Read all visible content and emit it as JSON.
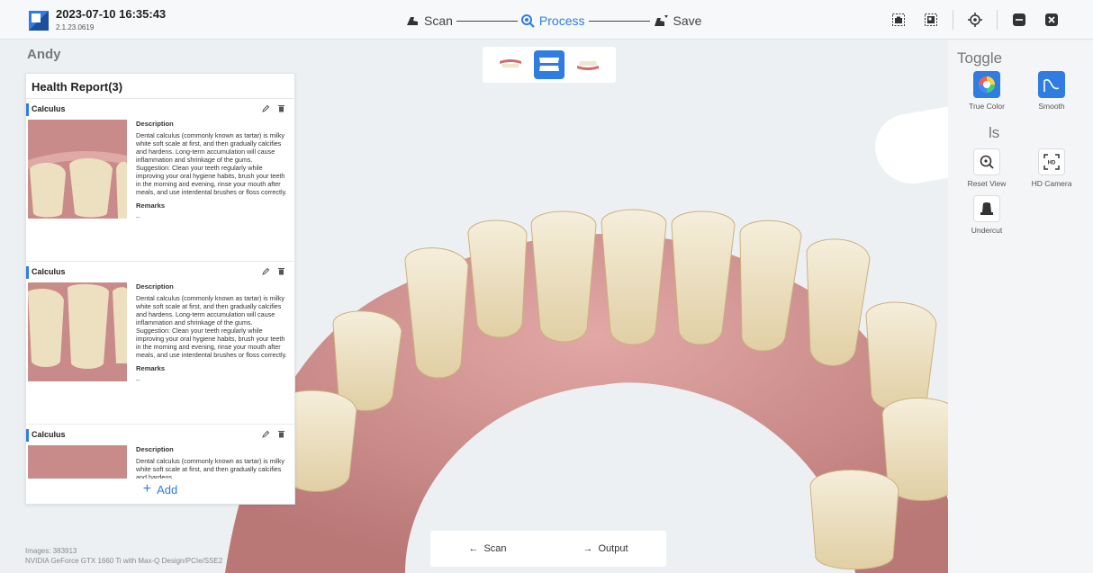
{
  "header": {
    "timestamp": "2023-07-10 16:35:43",
    "version": "2.1.23.0619",
    "steps": [
      {
        "label": "Scan",
        "icon": "scanner-icon",
        "active": false
      },
      {
        "label": "Process",
        "icon": "process-icon",
        "active": true
      },
      {
        "label": "Save",
        "icon": "save-icon",
        "active": false
      }
    ],
    "window_controls": [
      "screenshot-icon",
      "image-icon",
      "target-icon",
      "minimize-icon",
      "close-icon"
    ]
  },
  "patient": {
    "name": "Andy"
  },
  "health_report": {
    "title": "Health Report(3)",
    "desc_label": "Description",
    "remarks_label": "Remarks",
    "remarks_value": "--",
    "findings": [
      {
        "name": "Calculus",
        "description": "Dental calculus (commonly known as tartar) is milky white soft scale at first, and then gradually calcifies and hardens. Long-term accumulation will cause inflammation and shrinkage of the gums.",
        "suggestion": "Suggestion: Clean your teeth regularly while improving your oral hygiene habits, brush your teeth in the morning and evening, rinse your mouth after meals, and use interdental brushes or floss correctly."
      },
      {
        "name": "Calculus",
        "description": "Dental calculus (commonly known as tartar) is milky white soft scale at first, and then gradually calcifies and hardens. Long-term accumulation will cause inflammation and shrinkage of the gums.",
        "suggestion": "Suggestion: Clean your teeth regularly while improving your oral hygiene habits, brush your teeth in the morning and evening, rinse your mouth after meals, and use interdental brushes or floss correctly."
      },
      {
        "name": "Calculus",
        "description": "Dental calculus (commonly known as tartar) is milky white soft scale at first, and then gradually calcifies and hardens.",
        "suggestion": ""
      }
    ],
    "add_label": "Add"
  },
  "right_panel": {
    "toggle_heading": "Toggle",
    "tools_heading": "ls",
    "toggle_items": [
      {
        "label": "True Color",
        "icon": "true-color-icon"
      },
      {
        "label": "Smooth",
        "icon": "smooth-icon"
      }
    ],
    "tool_items": [
      {
        "label": "Reset View",
        "icon": "reset-view-icon"
      },
      {
        "label": "HD Camera",
        "icon": "hd-camera-icon"
      },
      {
        "label": "Undercut",
        "icon": "undercut-icon"
      }
    ]
  },
  "bottom_nav": {
    "back_label": "Scan",
    "next_label": "Output"
  },
  "status": {
    "images": "Images: 383913",
    "gpu": "NVIDIA GeForce GTX 1660 Ti with Max-Q Design/PCIe/SSE2"
  },
  "colors": {
    "accent": "#2f7de1",
    "gum": "#c98d8d",
    "tooth": "#efe6cf"
  }
}
